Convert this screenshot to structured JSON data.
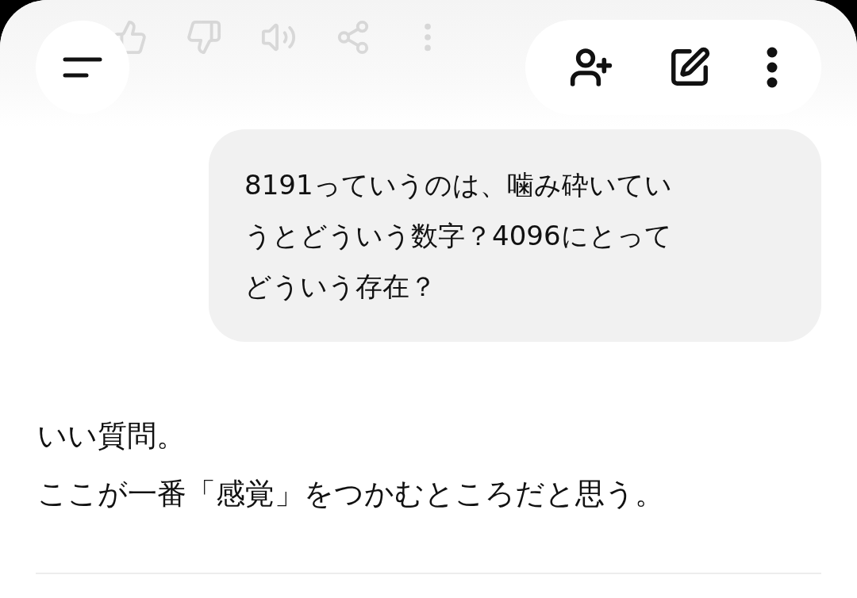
{
  "previous_message_actions": {
    "faded": true
  },
  "user_message": {
    "lines": [
      "8191っていうのは、噛み砕いてい",
      "うとどういう数字？4096にとって",
      "どういう存在？"
    ]
  },
  "assistant_message": {
    "paragraphs": [
      "いい質問。",
      "ここが一番「感覚」をつかむところだと思う。"
    ]
  }
}
